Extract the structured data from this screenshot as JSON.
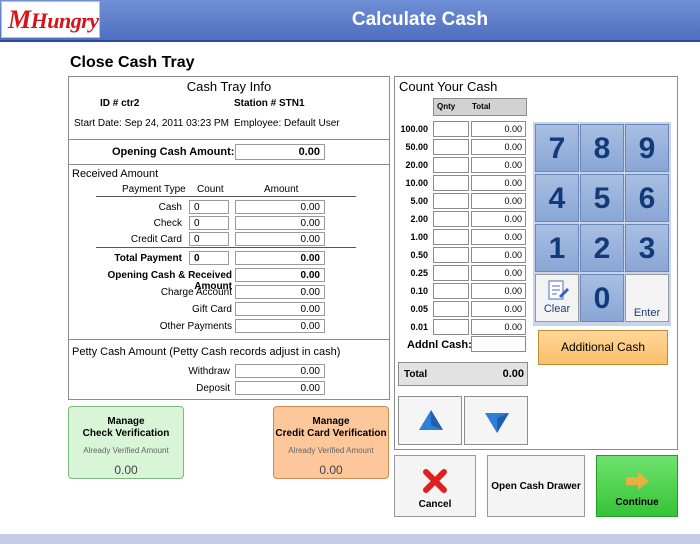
{
  "header": {
    "logo_prefix": "M",
    "logo_text": "Hungry",
    "title": "Calculate Cash"
  },
  "page_title": "Close Cash Tray",
  "tray_info": {
    "title": "Cash Tray Info",
    "id_label": "ID # ctr2",
    "station_label": "Station # STN1",
    "start_date": "Start Date: Sep 24, 2011 03:23 PM",
    "employee": "Employee: Default User"
  },
  "opening": {
    "label": "Opening Cash Amount:",
    "value": "0.00"
  },
  "received": {
    "title": "Received Amount",
    "col_type": "Payment Type",
    "col_count": "Count",
    "col_amount": "Amount",
    "rows": [
      {
        "label": "Cash",
        "count": "0",
        "amount": "0.00"
      },
      {
        "label": "Check",
        "count": "0",
        "amount": "0.00"
      },
      {
        "label": "Credit Card",
        "count": "0",
        "amount": "0.00"
      }
    ],
    "total_label": "Total Payment",
    "total_count": "0",
    "total_amount": "0.00",
    "opening_received_label": "Opening Cash & Received Amount",
    "opening_received_value": "0.00",
    "other_rows": [
      {
        "label": "Charge Account",
        "amount": "0.00"
      },
      {
        "label": "Gift Card",
        "amount": "0.00"
      },
      {
        "label": "Other Payments",
        "amount": "0.00"
      }
    ]
  },
  "petty": {
    "title": "Petty Cash Amount (Petty Cash records adjust in cash)",
    "rows": [
      {
        "label": "Withdraw",
        "amount": "0.00"
      },
      {
        "label": "Deposit",
        "amount": "0.00"
      }
    ]
  },
  "check_verification": {
    "title_1": "Manage",
    "title_2": "Check Verification",
    "sub": "Already Verified Amount",
    "value": "0.00"
  },
  "credit_verification": {
    "title_1": "Manage",
    "title_2": "Credit Card Verification",
    "sub": "Already Verified Amount",
    "value": "0.00"
  },
  "count_cash": {
    "title": "Count Your Cash",
    "col_qty": "Qnty",
    "col_total": "Total",
    "rows": [
      {
        "den": "100.00",
        "total": "0.00"
      },
      {
        "den": "50.00",
        "total": "0.00"
      },
      {
        "den": "20.00",
        "total": "0.00"
      },
      {
        "den": "10.00",
        "total": "0.00"
      },
      {
        "den": "5.00",
        "total": "0.00"
      },
      {
        "den": "2.00",
        "total": "0.00"
      },
      {
        "den": "1.00",
        "total": "0.00"
      },
      {
        "den": "0.50",
        "total": "0.00"
      },
      {
        "den": "0.25",
        "total": "0.00"
      },
      {
        "den": "0.10",
        "total": "0.00"
      },
      {
        "den": "0.05",
        "total": "0.00"
      },
      {
        "den": "0.01",
        "total": "0.00"
      }
    ],
    "addnl_label": "Addnl Cash:",
    "total_label": "Total",
    "total_value": "0.00"
  },
  "keypad": {
    "k7": "7",
    "k8": "8",
    "k9": "9",
    "k4": "4",
    "k5": "5",
    "k6": "6",
    "k1": "1",
    "k2": "2",
    "k3": "3",
    "clear": "Clear",
    "k0": "0",
    "enter": "Enter"
  },
  "additional_cash": "Additional Cash",
  "buttons": {
    "cancel": "Cancel",
    "open_drawer": "Open Cash Drawer",
    "continue": "Continue"
  },
  "colors": {
    "header_blue": "#5a7bc9",
    "keypad_blue": "#98b2dd",
    "orange": "#fbbf6a",
    "green": "#35c435",
    "cancel_red": "#e02020",
    "arrow_blue": "#2f7fd6"
  }
}
